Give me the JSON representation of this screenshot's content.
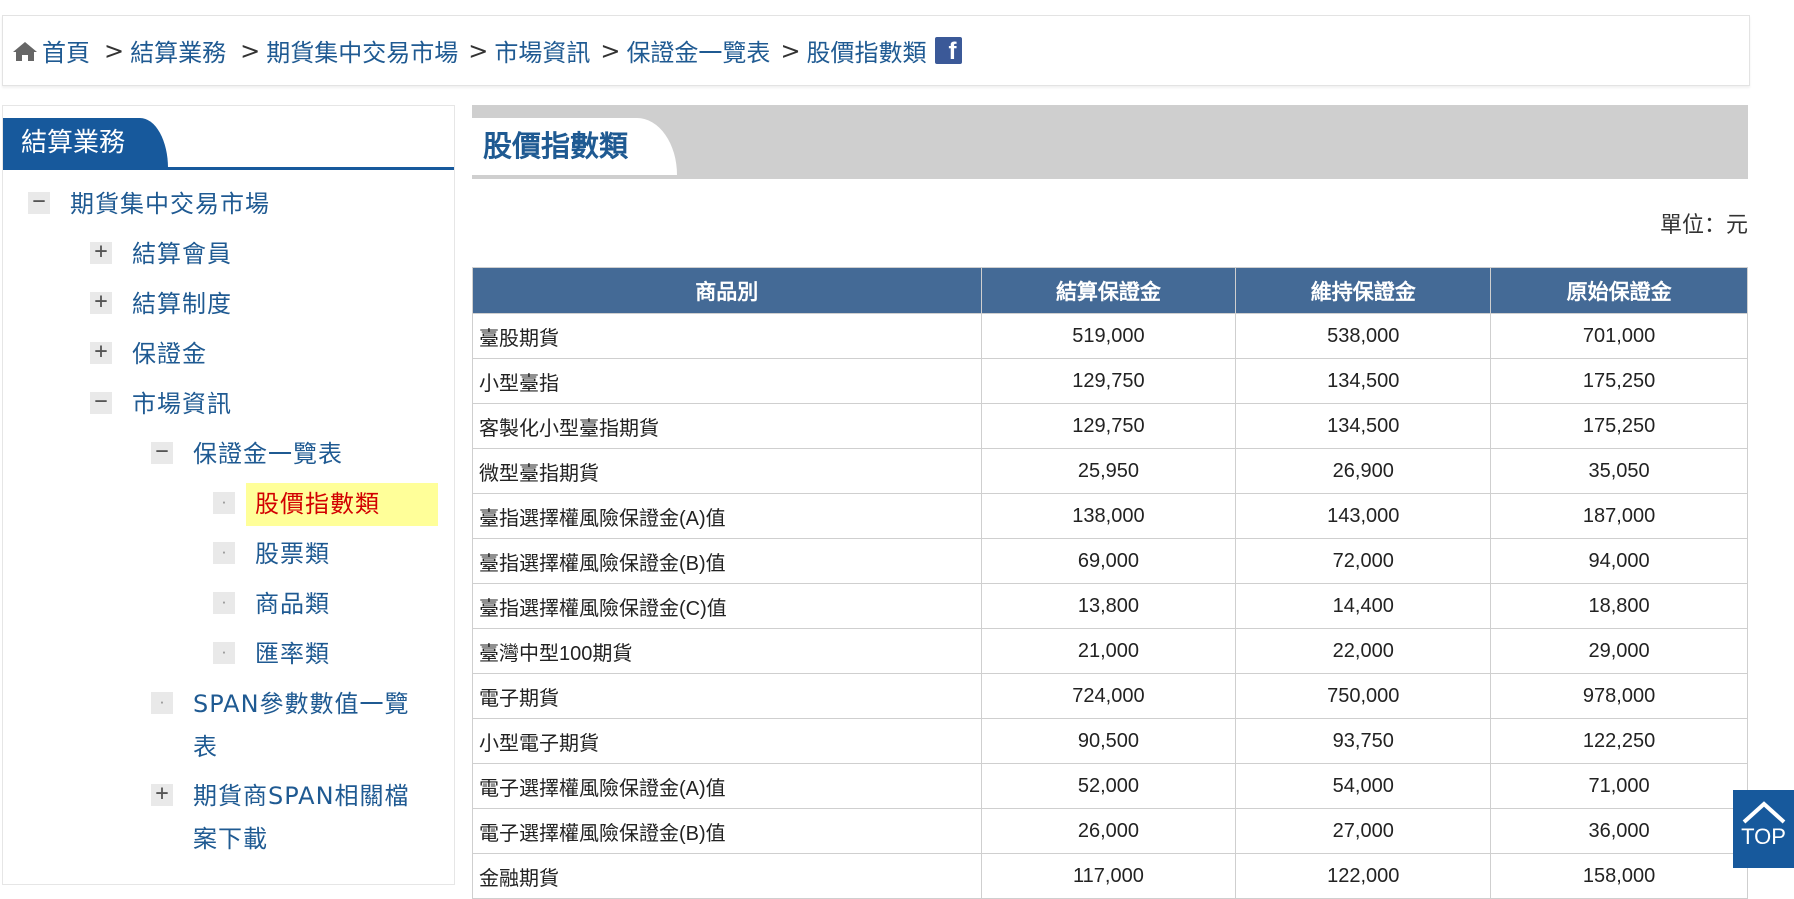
{
  "breadcrumb": {
    "items": [
      "首頁",
      "結算業務",
      "期貨集中交易市場",
      "市場資訊",
      "保證金一覽表",
      "股價指數類"
    ],
    "separator": ">",
    "share_icon": "facebook-icon"
  },
  "sidebar": {
    "title": "結算業務",
    "tree": [
      {
        "label": "期貨集中交易市場",
        "toggle": "−"
      },
      {
        "label": "結算會員",
        "toggle": "+"
      },
      {
        "label": "結算制度",
        "toggle": "+"
      },
      {
        "label": "保證金",
        "toggle": "+"
      },
      {
        "label": "市場資訊",
        "toggle": "−"
      },
      {
        "label": "保證金一覽表",
        "toggle": "−"
      },
      {
        "label": "股價指數類",
        "toggle": "·"
      },
      {
        "label": "股票類",
        "toggle": "·"
      },
      {
        "label": "商品類",
        "toggle": "·"
      },
      {
        "label": "匯率類",
        "toggle": "·"
      },
      {
        "label_line1": "SPAN參數數值一覽",
        "label_line2": "表",
        "toggle": "·"
      },
      {
        "label_line1": "期貨商SPAN相關檔",
        "label_line2": "案下載",
        "toggle": "+"
      }
    ]
  },
  "content": {
    "title": "股價指數類",
    "unit": "單位：元",
    "columns": [
      "商品別",
      "結算保證金",
      "維持保證金",
      "原始保證金"
    ],
    "rows": [
      [
        "臺股期貨",
        "519,000",
        "538,000",
        "701,000"
      ],
      [
        "小型臺指",
        "129,750",
        "134,500",
        "175,250"
      ],
      [
        "客製化小型臺指期貨",
        "129,750",
        "134,500",
        "175,250"
      ],
      [
        "微型臺指期貨",
        "25,950",
        "26,900",
        "35,050"
      ],
      [
        "臺指選擇權風險保證金(A)值",
        "138,000",
        "143,000",
        "187,000"
      ],
      [
        "臺指選擇權風險保證金(B)值",
        "69,000",
        "72,000",
        "94,000"
      ],
      [
        "臺指選擇權風險保證金(C)值",
        "13,800",
        "14,400",
        "18,800"
      ],
      [
        "臺灣中型100期貨",
        "21,000",
        "22,000",
        "29,000"
      ],
      [
        "電子期貨",
        "724,000",
        "750,000",
        "978,000"
      ],
      [
        "小型電子期貨",
        "90,500",
        "93,750",
        "122,250"
      ],
      [
        "電子選擇權風險保證金(A)值",
        "52,000",
        "54,000",
        "71,000"
      ],
      [
        "電子選擇權風險保證金(B)值",
        "26,000",
        "27,000",
        "36,000"
      ],
      [
        "金融期貨",
        "117,000",
        "122,000",
        "158,000"
      ]
    ]
  },
  "top_button": {
    "label": "TOP"
  },
  "colors": {
    "brand": "#17599c",
    "link": "#1f5a92",
    "table_header": "#446a96",
    "highlight": "#ffff99",
    "active_text": "#d20000"
  }
}
